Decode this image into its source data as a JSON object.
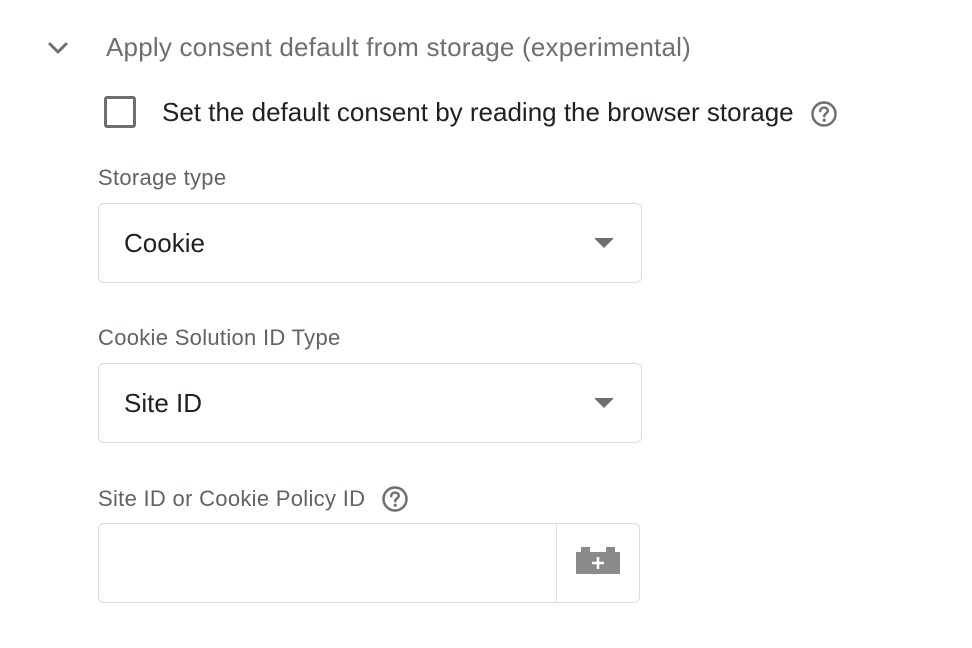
{
  "section": {
    "title": "Apply consent default from storage (experimental)",
    "icon": "chevron-down-icon",
    "expanded": true
  },
  "read_storage": {
    "label": "Set the default consent by reading the browser storage",
    "checked": false,
    "help_icon": "help-circle-icon"
  },
  "storage_type": {
    "label": "Storage type",
    "value": "Cookie"
  },
  "id_type": {
    "label": "Cookie Solution ID Type",
    "value": "Site ID"
  },
  "site_id": {
    "label": "Site ID or Cookie Policy ID",
    "value": "",
    "placeholder": "",
    "help_icon": "help-circle-icon",
    "variable_icon": "add-variable-icon"
  },
  "colors": {
    "text_primary": "#202124",
    "text_secondary": "#5f6368",
    "icon_gray": "#6f6f6f",
    "border": "#dadce0"
  }
}
